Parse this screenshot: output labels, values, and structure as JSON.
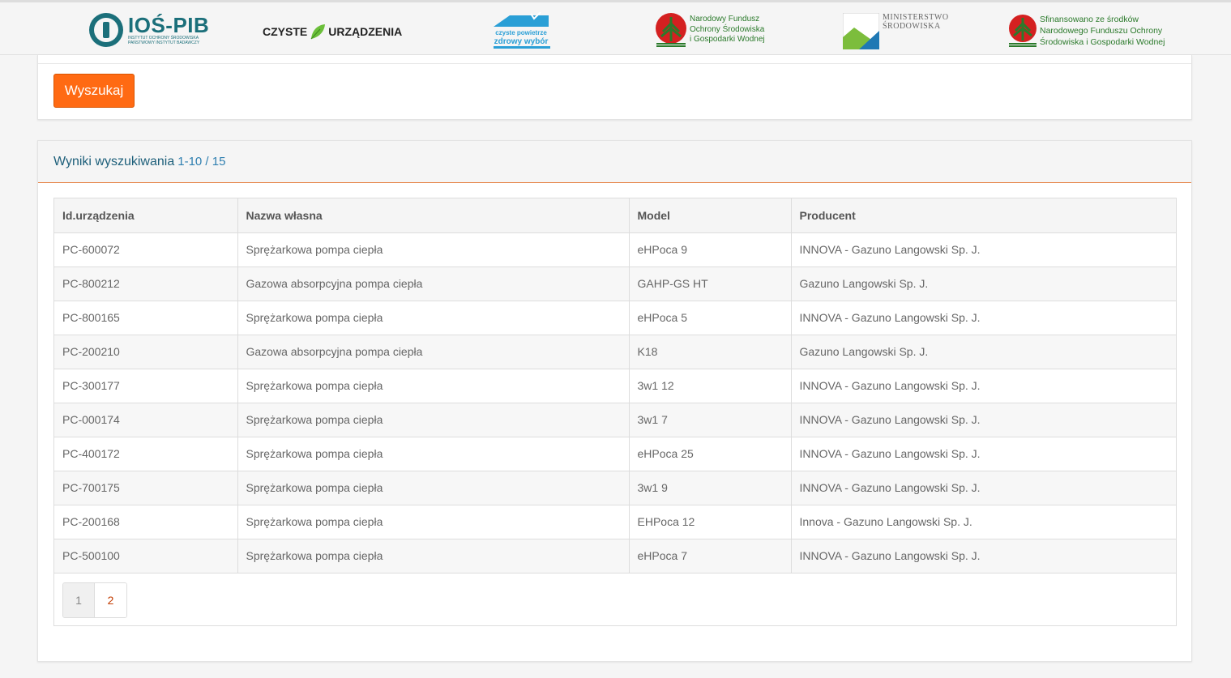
{
  "logos": {
    "ios": {
      "name": "IOŚ-PIB",
      "subtitle": "INSTYTUT OCHRONY ŚRODOWISKA PAŃSTWOWY INSTYTUT BADAWCZY"
    },
    "czyste": {
      "left": "CZYSTE",
      "right": "URZĄDZENIA"
    },
    "cp": {
      "line1": "czyste powietrze",
      "line2": "zdrowy wybór"
    },
    "nfosigw": {
      "line1": "Narodowy Fundusz",
      "line2": "Ochrony Środowiska",
      "line3": "i Gospodarki Wodnej"
    },
    "ministerstwo": {
      "line1": "MINISTERSTWO",
      "line2": "ŚRODOWISKA"
    },
    "sfinansowano": {
      "line1": "Sfinansowano ze środków",
      "line2": "Narodowego Funduszu Ochrony",
      "line3": "Środowiska i Gospodarki Wodnej"
    }
  },
  "search": {
    "button_label": "Wyszukaj"
  },
  "results": {
    "title": "Wyniki wyszukiwania",
    "range": "1-10 / 15",
    "columns": [
      "Id.urządzenia",
      "Nazwa własna",
      "Model",
      "Producent"
    ],
    "rows": [
      [
        "PC-600072",
        "Sprężarkowa pompa ciepła",
        "eHPoca 9",
        "INNOVA - Gazuno Langowski Sp. J."
      ],
      [
        "PC-800212",
        "Gazowa absorpcyjna pompa ciepła",
        "GAHP-GS HT",
        "Gazuno Langowski Sp. J."
      ],
      [
        "PC-800165",
        "Sprężarkowa pompa ciepła",
        "eHPoca 5",
        "INNOVA - Gazuno Langowski Sp. J."
      ],
      [
        "PC-200210",
        "Gazowa absorpcyjna pompa ciepła",
        "K18",
        "Gazuno Langowski Sp. J."
      ],
      [
        "PC-300177",
        "Sprężarkowa pompa ciepła",
        "3w1 12",
        "INNOVA - Gazuno Langowski Sp. J."
      ],
      [
        "PC-000174",
        "Sprężarkowa pompa ciepła",
        "3w1 7",
        "INNOVA - Gazuno Langowski Sp. J."
      ],
      [
        "PC-400172",
        "Sprężarkowa pompa ciepła",
        "eHPoca 25",
        "INNOVA - Gazuno Langowski Sp. J."
      ],
      [
        "PC-700175",
        "Sprężarkowa pompa ciepła",
        "3w1 9",
        "INNOVA - Gazuno Langowski Sp. J."
      ],
      [
        "PC-200168",
        "Sprężarkowa pompa ciepła",
        "EHPoca 12",
        "Innova - Gazuno Langowski Sp. J."
      ],
      [
        "PC-500100",
        "Sprężarkowa pompa ciepła",
        "eHPoca 7",
        "INNOVA - Gazuno Langowski Sp. J."
      ]
    ],
    "pages": [
      "1",
      "2"
    ],
    "current_page": "1"
  },
  "colors": {
    "accent": "#ff6a13",
    "title": "#1d5f7a",
    "link": "#c23b00"
  }
}
